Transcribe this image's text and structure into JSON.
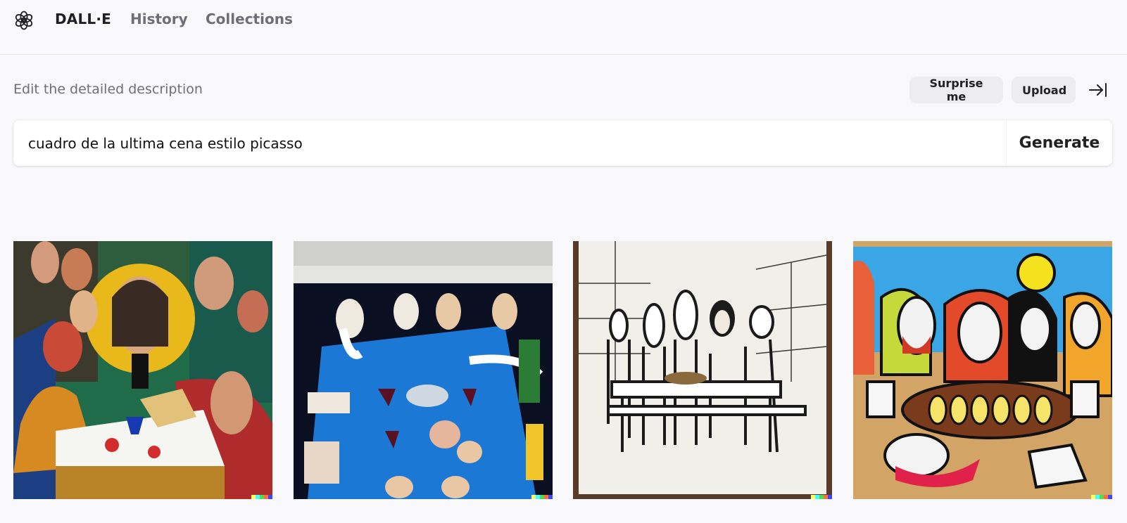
{
  "header": {
    "brand": "DALL·E",
    "nav": [
      {
        "label": "History"
      },
      {
        "label": "Collections"
      }
    ]
  },
  "prompt": {
    "label": "Edit the detailed description",
    "surprise_label": "Surprise me",
    "upload_label": "Upload",
    "value": "cuadro de la ultima cena estilo picasso",
    "generate_label": "Generate"
  },
  "results": {
    "images": [
      {
        "icon": "generated-image",
        "style": "colorful-cubist-painting"
      },
      {
        "icon": "generated-image",
        "style": "blue-table-top-view-painting"
      },
      {
        "icon": "generated-image",
        "style": "line-sketch"
      },
      {
        "icon": "generated-image",
        "style": "bold-outline-painting"
      }
    ],
    "watermark_colors": [
      "#ffff66",
      "#42ffff",
      "#51da4c",
      "#ff6e3c",
      "#3c46ff"
    ]
  },
  "colors": {
    "background": "#f9f9fb",
    "pill_bg": "#ececf1",
    "text_primary": "#202123",
    "text_muted": "#6e6e78"
  }
}
